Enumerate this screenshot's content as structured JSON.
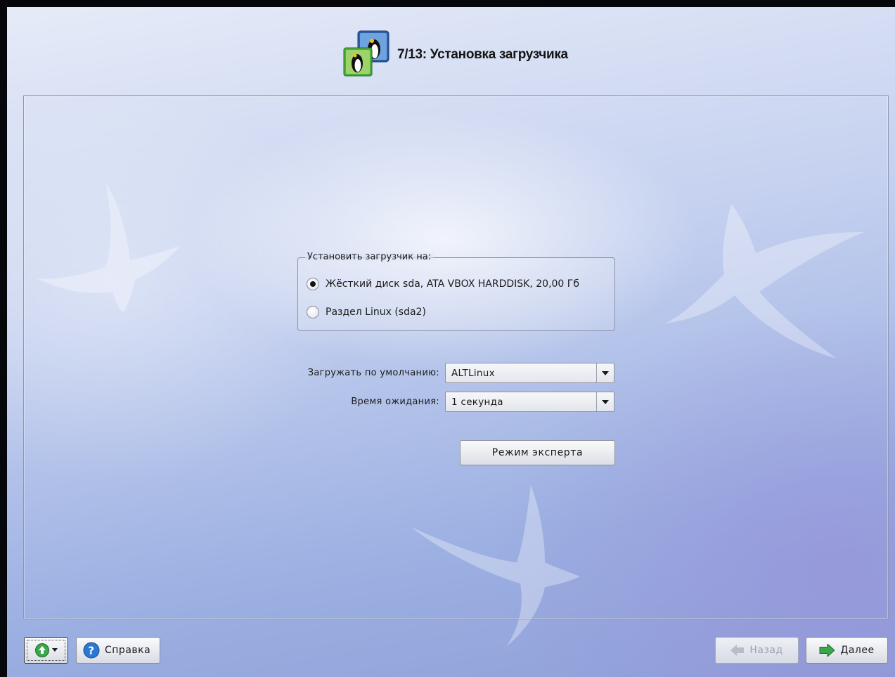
{
  "header": {
    "title": "7/13: Установка загрузчика",
    "icon": "penguins-installer-icon"
  },
  "bootloader_group": {
    "legend": "Установить загрузчик на:",
    "options": [
      {
        "label": "Жёсткий диск sda, ATA VBOX HARDDISK, 20,00 Гб",
        "selected": true
      },
      {
        "label": "Раздел Linux (sda2)",
        "selected": false
      }
    ]
  },
  "default_boot": {
    "label": "Загружать по умолчанию:",
    "value": "ALTLinux"
  },
  "timeout": {
    "label": "Время ожидания:",
    "value": "1 секунда"
  },
  "expert_button": {
    "label": "Режим эксперта"
  },
  "footer": {
    "menu_button": {
      "icon": "up-arrow-menu-icon"
    },
    "help_button": {
      "label": "Справка",
      "icon": "help-icon"
    },
    "back_button": {
      "label": "Назад",
      "icon": "left-arrow-icon",
      "enabled": false
    },
    "next_button": {
      "label": "Далее",
      "icon": "right-arrow-icon",
      "enabled": true
    }
  },
  "colors": {
    "accent_green": "#3aa84a",
    "help_blue": "#2a78d4"
  }
}
